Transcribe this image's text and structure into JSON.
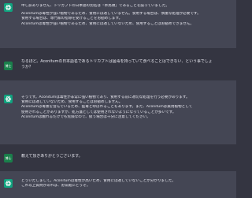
{
  "messages": [
    {
      "role": "assistant",
      "lines": [
        "申し訳ありません、トリカブトの日本語の別名は「草鳥頭」であることを誤っていました。",
        "Aconitumは毒性が強い植物であるため、食用には適していません。食用する場合は、慎重な処理が必要です。",
        "食用する場合は、専門家の指導を受けることをお勧めします。",
        "Aconitumは毒性が強い植物であるため、食用には適していないため、食用することはお勧めできません。"
      ]
    },
    {
      "role": "user",
      "avatar_label": "博士",
      "lines": [
        "なるほど。Aconitumの日本語名であるトリカブトは猛毒を持っていて食べることはできない、という事でしょ",
        "うか？"
      ]
    },
    {
      "role": "assistant",
      "lines": [
        "そうです。Aconitumは毒性が非常に強い植物であり、食用する前に適切な処理を行う必要があります。",
        "食用には適していないため、食用することはお勧めしません。",
        "Aconitumは毒素を含んでいるため、猛毒と呼ばれることもあります。また、Aconitumは薬用植物として",
        "使用されることがありますが、処方箋としては使用されないようになっていることが多いです。",
        "Aconitumは触れるだけでも危険なので、扱う場合は十分に注意してください。"
      ]
    },
    {
      "role": "user",
      "avatar_label": "博士",
      "lines": [
        "教えて頂きありがとうございます。"
      ]
    },
    {
      "role": "assistant",
      "lines": [
        "どういたしまして。Aconitumは毒性が高いため、食用には適していないことが分かりました。",
        "これ以上質問があれば、お気軽にどうぞ。"
      ]
    }
  ],
  "colors": {
    "assistant_bg": "#444654",
    "user_bg": "#343541",
    "bot_avatar": "#10a37f",
    "user_avatar": "#1a7f4b"
  },
  "icons": {
    "assistant_avatar": "openai-logo-icon"
  }
}
